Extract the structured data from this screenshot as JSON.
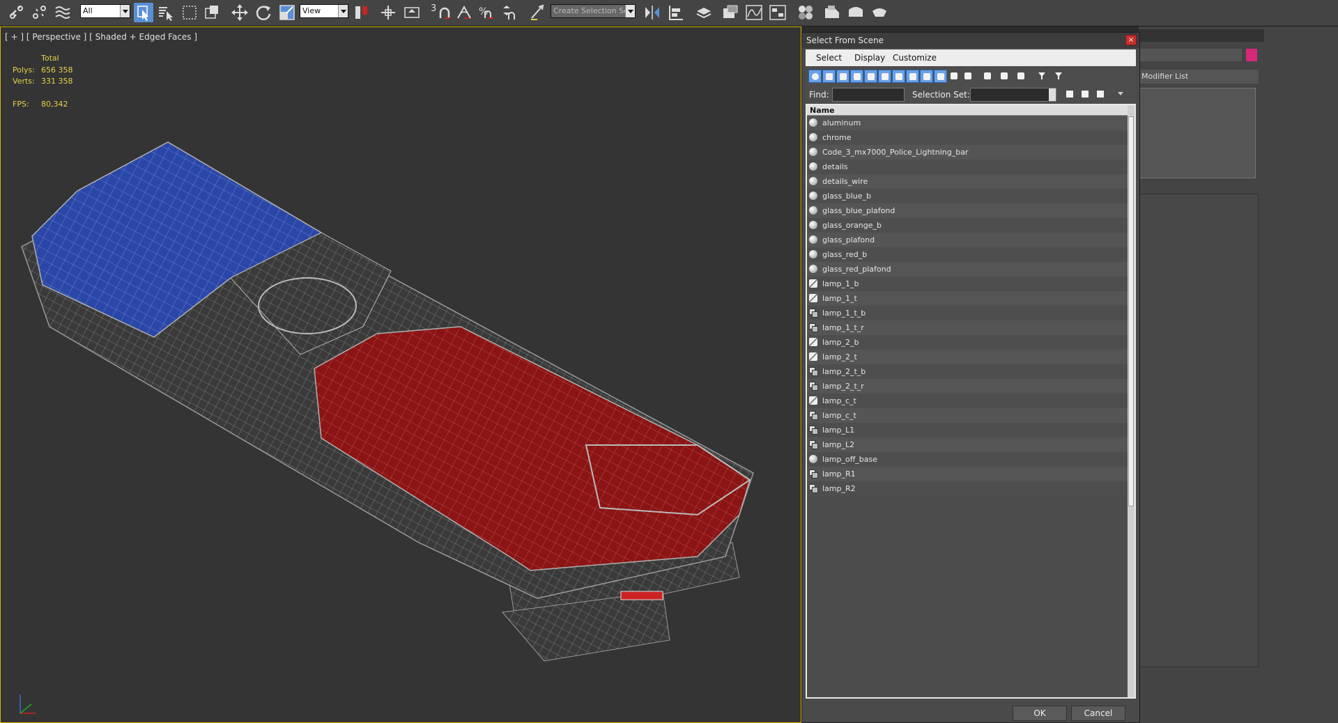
{
  "toolbar": {
    "selection_filter": "All",
    "reference_coord": "View",
    "named_selection_placeholder": "Create Selection Se",
    "snap_label": "3",
    "accent": "#5a8fd6"
  },
  "viewport": {
    "label": "[ + ] [ Perspective ] [ Shaded + Edged Faces ]",
    "stats": {
      "total_label": "Total",
      "polys_label": "Polys:",
      "polys_value": "656 358",
      "verts_label": "Verts:",
      "verts_value": "331 358",
      "fps_label": "FPS:",
      "fps_value": "80,342"
    },
    "model_colors": {
      "blue": "#2a47a8",
      "red": "#8b1414",
      "frame": "#8a8a8a"
    }
  },
  "command_panel": {
    "modifier_list": "Modifier List",
    "color_swatch": "#d6287a"
  },
  "dialog": {
    "title": "Select From Scene",
    "close_glyph": "×",
    "menu": [
      "Select",
      "Display",
      "Customize"
    ],
    "find_label": "Find:",
    "selection_set_label": "Selection Set:",
    "column_name": "Name",
    "items": [
      {
        "name": "aluminum",
        "icon": "material-sphere-icon"
      },
      {
        "name": "chrome",
        "icon": "material-sphere-icon"
      },
      {
        "name": "Code_3_mx7000_Police_Lightning_bar",
        "icon": "material-sphere-icon"
      },
      {
        "name": "details",
        "icon": "material-sphere-icon"
      },
      {
        "name": "details_wire",
        "icon": "material-sphere-icon"
      },
      {
        "name": "glass_blue_b",
        "icon": "material-sphere-icon"
      },
      {
        "name": "glass_blue_plafond",
        "icon": "material-sphere-icon"
      },
      {
        "name": "glass_orange_b",
        "icon": "material-sphere-icon"
      },
      {
        "name": "glass_plafond",
        "icon": "material-sphere-icon"
      },
      {
        "name": "glass_red_b",
        "icon": "material-sphere-icon"
      },
      {
        "name": "glass_red_plafond",
        "icon": "material-sphere-icon"
      },
      {
        "name": "lamp_1_b",
        "icon": "light-icon"
      },
      {
        "name": "lamp_1_t",
        "icon": "light-icon"
      },
      {
        "name": "lamp_1_t_b",
        "icon": "group-icon"
      },
      {
        "name": "lamp_1_t_r",
        "icon": "group-icon"
      },
      {
        "name": "lamp_2_b",
        "icon": "light-icon"
      },
      {
        "name": "lamp_2_t",
        "icon": "light-icon"
      },
      {
        "name": "lamp_2_t_b",
        "icon": "group-icon"
      },
      {
        "name": "lamp_2_t_r",
        "icon": "group-icon"
      },
      {
        "name": "lamp_c_t",
        "icon": "light-icon"
      },
      {
        "name": "lamp_c_t",
        "icon": "group-icon"
      },
      {
        "name": "lamp_L1",
        "icon": "group-icon"
      },
      {
        "name": "lamp_L2",
        "icon": "group-icon"
      },
      {
        "name": "lamp_off_base",
        "icon": "material-sphere-icon"
      },
      {
        "name": "lamp_R1",
        "icon": "group-icon"
      },
      {
        "name": "lamp_R2",
        "icon": "group-icon"
      }
    ],
    "ok_label": "OK",
    "cancel_label": "Cancel"
  }
}
